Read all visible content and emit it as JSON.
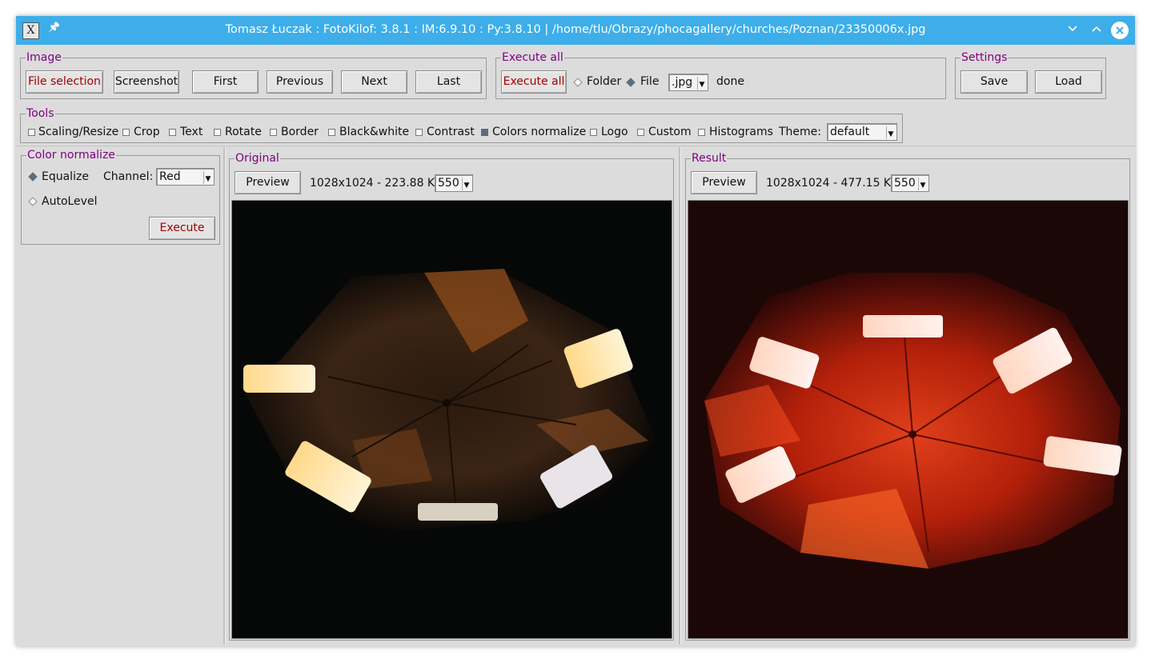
{
  "window": {
    "title": "Tomasz Łuczak : FotoKilof: 3.8.1 : IM:6.9.10 : Py:3.8.10 | /home/tlu/Obrazy/phocagallery/churches/Poznan/23350006x.jpg",
    "app_icon": "X",
    "pin_glyph": "📌",
    "minimize_glyph": "⌄",
    "maximize_glyph": "^",
    "close_glyph": "✕"
  },
  "image_group": {
    "legend": "Image",
    "buttons": {
      "file_selection": "File selection",
      "screenshot": "Screenshot",
      "first": "First",
      "previous": "Previous",
      "next": "Next",
      "last": "Last"
    }
  },
  "execute_all_group": {
    "legend": "Execute all",
    "execute_button": "Execute all",
    "folder_label": "Folder",
    "file_label": "File",
    "folder_selected": false,
    "file_selected": true,
    "extension": ".jpg",
    "status": "done"
  },
  "settings_group": {
    "legend": "Settings",
    "save": "Save",
    "load": "Load"
  },
  "tools_group": {
    "legend": "Tools",
    "items": [
      {
        "label": "Scaling/Resize",
        "checked": false
      },
      {
        "label": "Crop",
        "checked": false
      },
      {
        "label": "Text",
        "checked": false
      },
      {
        "label": "Rotate",
        "checked": false
      },
      {
        "label": "Border",
        "checked": false
      },
      {
        "label": "Black&white",
        "checked": false
      },
      {
        "label": "Contrast",
        "checked": false
      },
      {
        "label": "Colors normalize",
        "checked": true
      },
      {
        "label": "Logo",
        "checked": false
      },
      {
        "label": "Custom",
        "checked": false
      },
      {
        "label": "Histograms",
        "checked": false
      }
    ],
    "theme_label": "Theme:",
    "theme_value": "default"
  },
  "color_normalize": {
    "legend": "Color normalize",
    "equalize_label": "Equalize",
    "equalize_selected": true,
    "channel_label": "Channel:",
    "channel_value": "Red",
    "autolevel_label": "AutoLevel",
    "autolevel_selected": false,
    "execute_button": "Execute"
  },
  "original": {
    "legend": "Original",
    "preview_button": "Preview",
    "info": "1028x1024 - 223.88 KB",
    "size_value": "550"
  },
  "result": {
    "legend": "Result",
    "preview_button": "Preview",
    "info": "1028x1024 - 477.15 KB",
    "size_value": "550"
  },
  "colors": {
    "titlebar": "#3daee9",
    "legend": "#800080",
    "red_text": "#a00000",
    "checked": "#5a6e80"
  }
}
